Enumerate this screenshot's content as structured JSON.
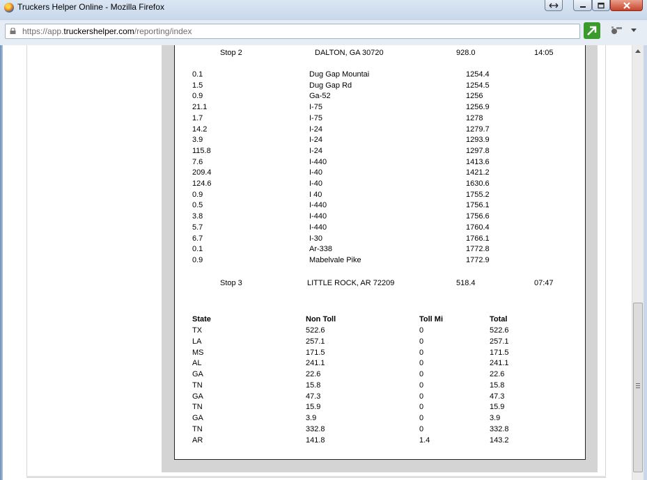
{
  "window": {
    "title": "Truckers Helper Online - Mozilla Firefox",
    "icon": "firefox-icon",
    "controls": [
      "restore-icon",
      "minimize-icon",
      "maximize-icon",
      "close-icon"
    ]
  },
  "address_bar": {
    "url_prefix": "https://app.",
    "url_domain": "truckershelper.com",
    "url_path": "/reporting/index",
    "icons": [
      "lock-icon",
      "green-arrow-icon",
      "tools-icon",
      "dropdown-arrow-icon"
    ]
  },
  "report": {
    "stop2": {
      "label": "Stop 2",
      "location": "DALTON, GA 30720",
      "miles": "928.0",
      "time": "14:05"
    },
    "segments": [
      {
        "miles": "0.1",
        "road": "Dug Gap Mountai",
        "cumulative": "1254.4"
      },
      {
        "miles": "1.5",
        "road": "Dug Gap Rd",
        "cumulative": "1254.5"
      },
      {
        "miles": "0.9",
        "road": "Ga-52",
        "cumulative": "1256"
      },
      {
        "miles": "21.1",
        "road": "I-75",
        "cumulative": "1256.9"
      },
      {
        "miles": "1.7",
        "road": "I-75",
        "cumulative": "1278"
      },
      {
        "miles": "14.2",
        "road": "I-24",
        "cumulative": "1279.7"
      },
      {
        "miles": "3.9",
        "road": "I-24",
        "cumulative": "1293.9"
      },
      {
        "miles": "115.8",
        "road": "I-24",
        "cumulative": "1297.8"
      },
      {
        "miles": "7.6",
        "road": "I-440",
        "cumulative": "1413.6"
      },
      {
        "miles": "209.4",
        "road": "I-40",
        "cumulative": "1421.2"
      },
      {
        "miles": "124.6",
        "road": "I-40",
        "cumulative": "1630.6"
      },
      {
        "miles": "0.9",
        "road": "I 40",
        "cumulative": "1755.2"
      },
      {
        "miles": "0.5",
        "road": "I-440",
        "cumulative": "1756.1"
      },
      {
        "miles": "3.8",
        "road": "I-440",
        "cumulative": "1756.6"
      },
      {
        "miles": "5.7",
        "road": "I-440",
        "cumulative": "1760.4"
      },
      {
        "miles": "6.7",
        "road": "I-30",
        "cumulative": "1766.1"
      },
      {
        "miles": "0.1",
        "road": "Ar-338",
        "cumulative": "1772.8"
      },
      {
        "miles": "0.9",
        "road": "Mabelvale Pike",
        "cumulative": "1772.9"
      }
    ],
    "stop3": {
      "label": "Stop 3",
      "location": "LITTLE ROCK, AR 72209",
      "miles": "518.4",
      "time": "07:47"
    },
    "state_table": {
      "headers": {
        "state": "State",
        "non_toll": "Non Toll",
        "toll": "Toll Mi",
        "total": "Total"
      },
      "rows": [
        {
          "state": "TX",
          "non_toll": "522.6",
          "toll": "0",
          "total": "522.6"
        },
        {
          "state": "LA",
          "non_toll": "257.1",
          "toll": "0",
          "total": "257.1"
        },
        {
          "state": "MS",
          "non_toll": "171.5",
          "toll": "0",
          "total": "171.5"
        },
        {
          "state": "AL",
          "non_toll": "241.1",
          "toll": "0",
          "total": "241.1"
        },
        {
          "state": "GA",
          "non_toll": "22.6",
          "toll": "0",
          "total": "22.6"
        },
        {
          "state": "TN",
          "non_toll": "15.8",
          "toll": "0",
          "total": "15.8"
        },
        {
          "state": "GA",
          "non_toll": "47.3",
          "toll": "0",
          "total": "47.3"
        },
        {
          "state": "TN",
          "non_toll": "15.9",
          "toll": "0",
          "total": "15.9"
        },
        {
          "state": "GA",
          "non_toll": "3.9",
          "toll": "0",
          "total": "3.9"
        },
        {
          "state": "TN",
          "non_toll": "332.8",
          "toll": "0",
          "total": "332.8"
        },
        {
          "state": "AR",
          "non_toll": "141.8",
          "toll": "1.4",
          "total": "143.2"
        }
      ]
    }
  },
  "colors": {
    "titlebar": "#c7d7ea",
    "close_button": "#c7452d",
    "panel_gray": "#d4d4d4"
  }
}
